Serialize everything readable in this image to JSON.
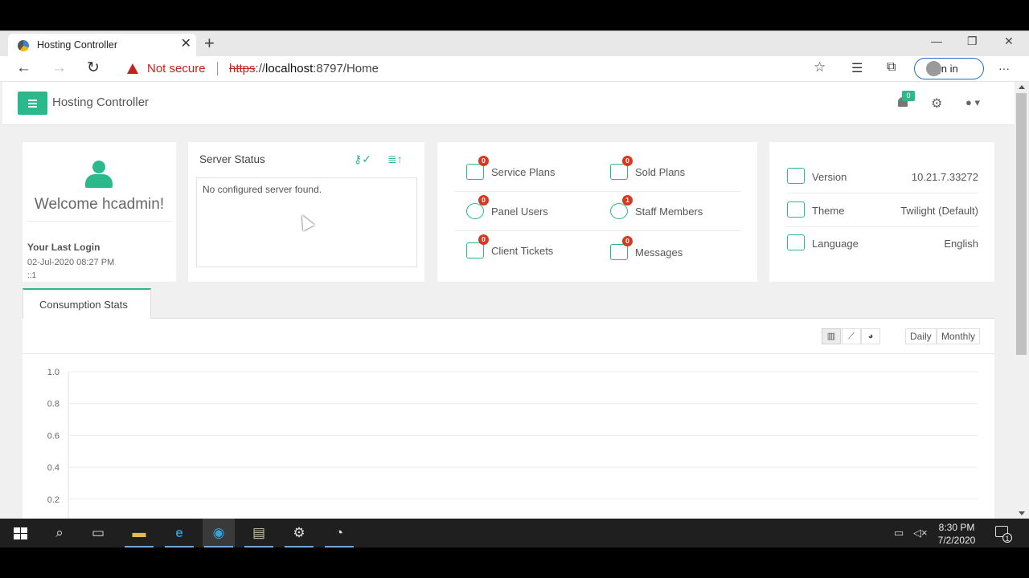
{
  "browser": {
    "tab_title": "Hosting Controller",
    "new_tab": "+",
    "tab_close": "✕",
    "not_secure": "Not secure",
    "url_scheme": "https",
    "url_rest": "://",
    "url_host": "localhost",
    "url_path": ":8797/Home",
    "sign_in": "Sign in",
    "win_min": "—",
    "win_restore": "❐",
    "win_close": "✕",
    "more": "···"
  },
  "app": {
    "title": "Hosting Controller",
    "notification_count": "0"
  },
  "welcome": {
    "greeting": "Welcome hcadmin!",
    "last_login_label": "Your Last Login",
    "last_login_date": "02-Jul-2020 08:27 PM",
    "last_login_ip": "::1"
  },
  "server_status": {
    "title": "Server Status",
    "message": "No configured server found."
  },
  "stats": [
    {
      "label": "Service Plans",
      "count": "0",
      "icon": "service-plans-icon"
    },
    {
      "label": "Sold Plans",
      "count": "0",
      "icon": "sold-plans-icon"
    },
    {
      "label": "Panel Users",
      "count": "0",
      "icon": "panel-users-icon"
    },
    {
      "label": "Staff Members",
      "count": "1",
      "icon": "staff-members-icon"
    },
    {
      "label": "Client Tickets",
      "count": "0",
      "icon": "client-tickets-icon"
    },
    {
      "label": "Messages",
      "count": "0",
      "icon": "messages-icon"
    }
  ],
  "info": [
    {
      "label": "Version",
      "value": "10.21.7.33272"
    },
    {
      "label": "Theme",
      "value": "Twilight (Default)"
    },
    {
      "label": "Language",
      "value": "English"
    }
  ],
  "consumption": {
    "tab_label": "Consumption Stats",
    "period_daily": "Daily",
    "period_monthly": "Monthly"
  },
  "chart_data": {
    "type": "bar",
    "categories": [],
    "series": [],
    "yticks": [
      "1.0",
      "0.8",
      "0.6",
      "0.4",
      "0.2"
    ],
    "ylim": [
      0,
      1.0
    ],
    "grid": true,
    "title": "",
    "xlabel": "",
    "ylabel": ""
  },
  "taskbar": {
    "time": "8:30 PM",
    "date": "7/2/2020",
    "notification_count": "1"
  },
  "colors": {
    "accent": "#2bb88a",
    "badge": "#d6391f",
    "warning": "#c5221f"
  }
}
